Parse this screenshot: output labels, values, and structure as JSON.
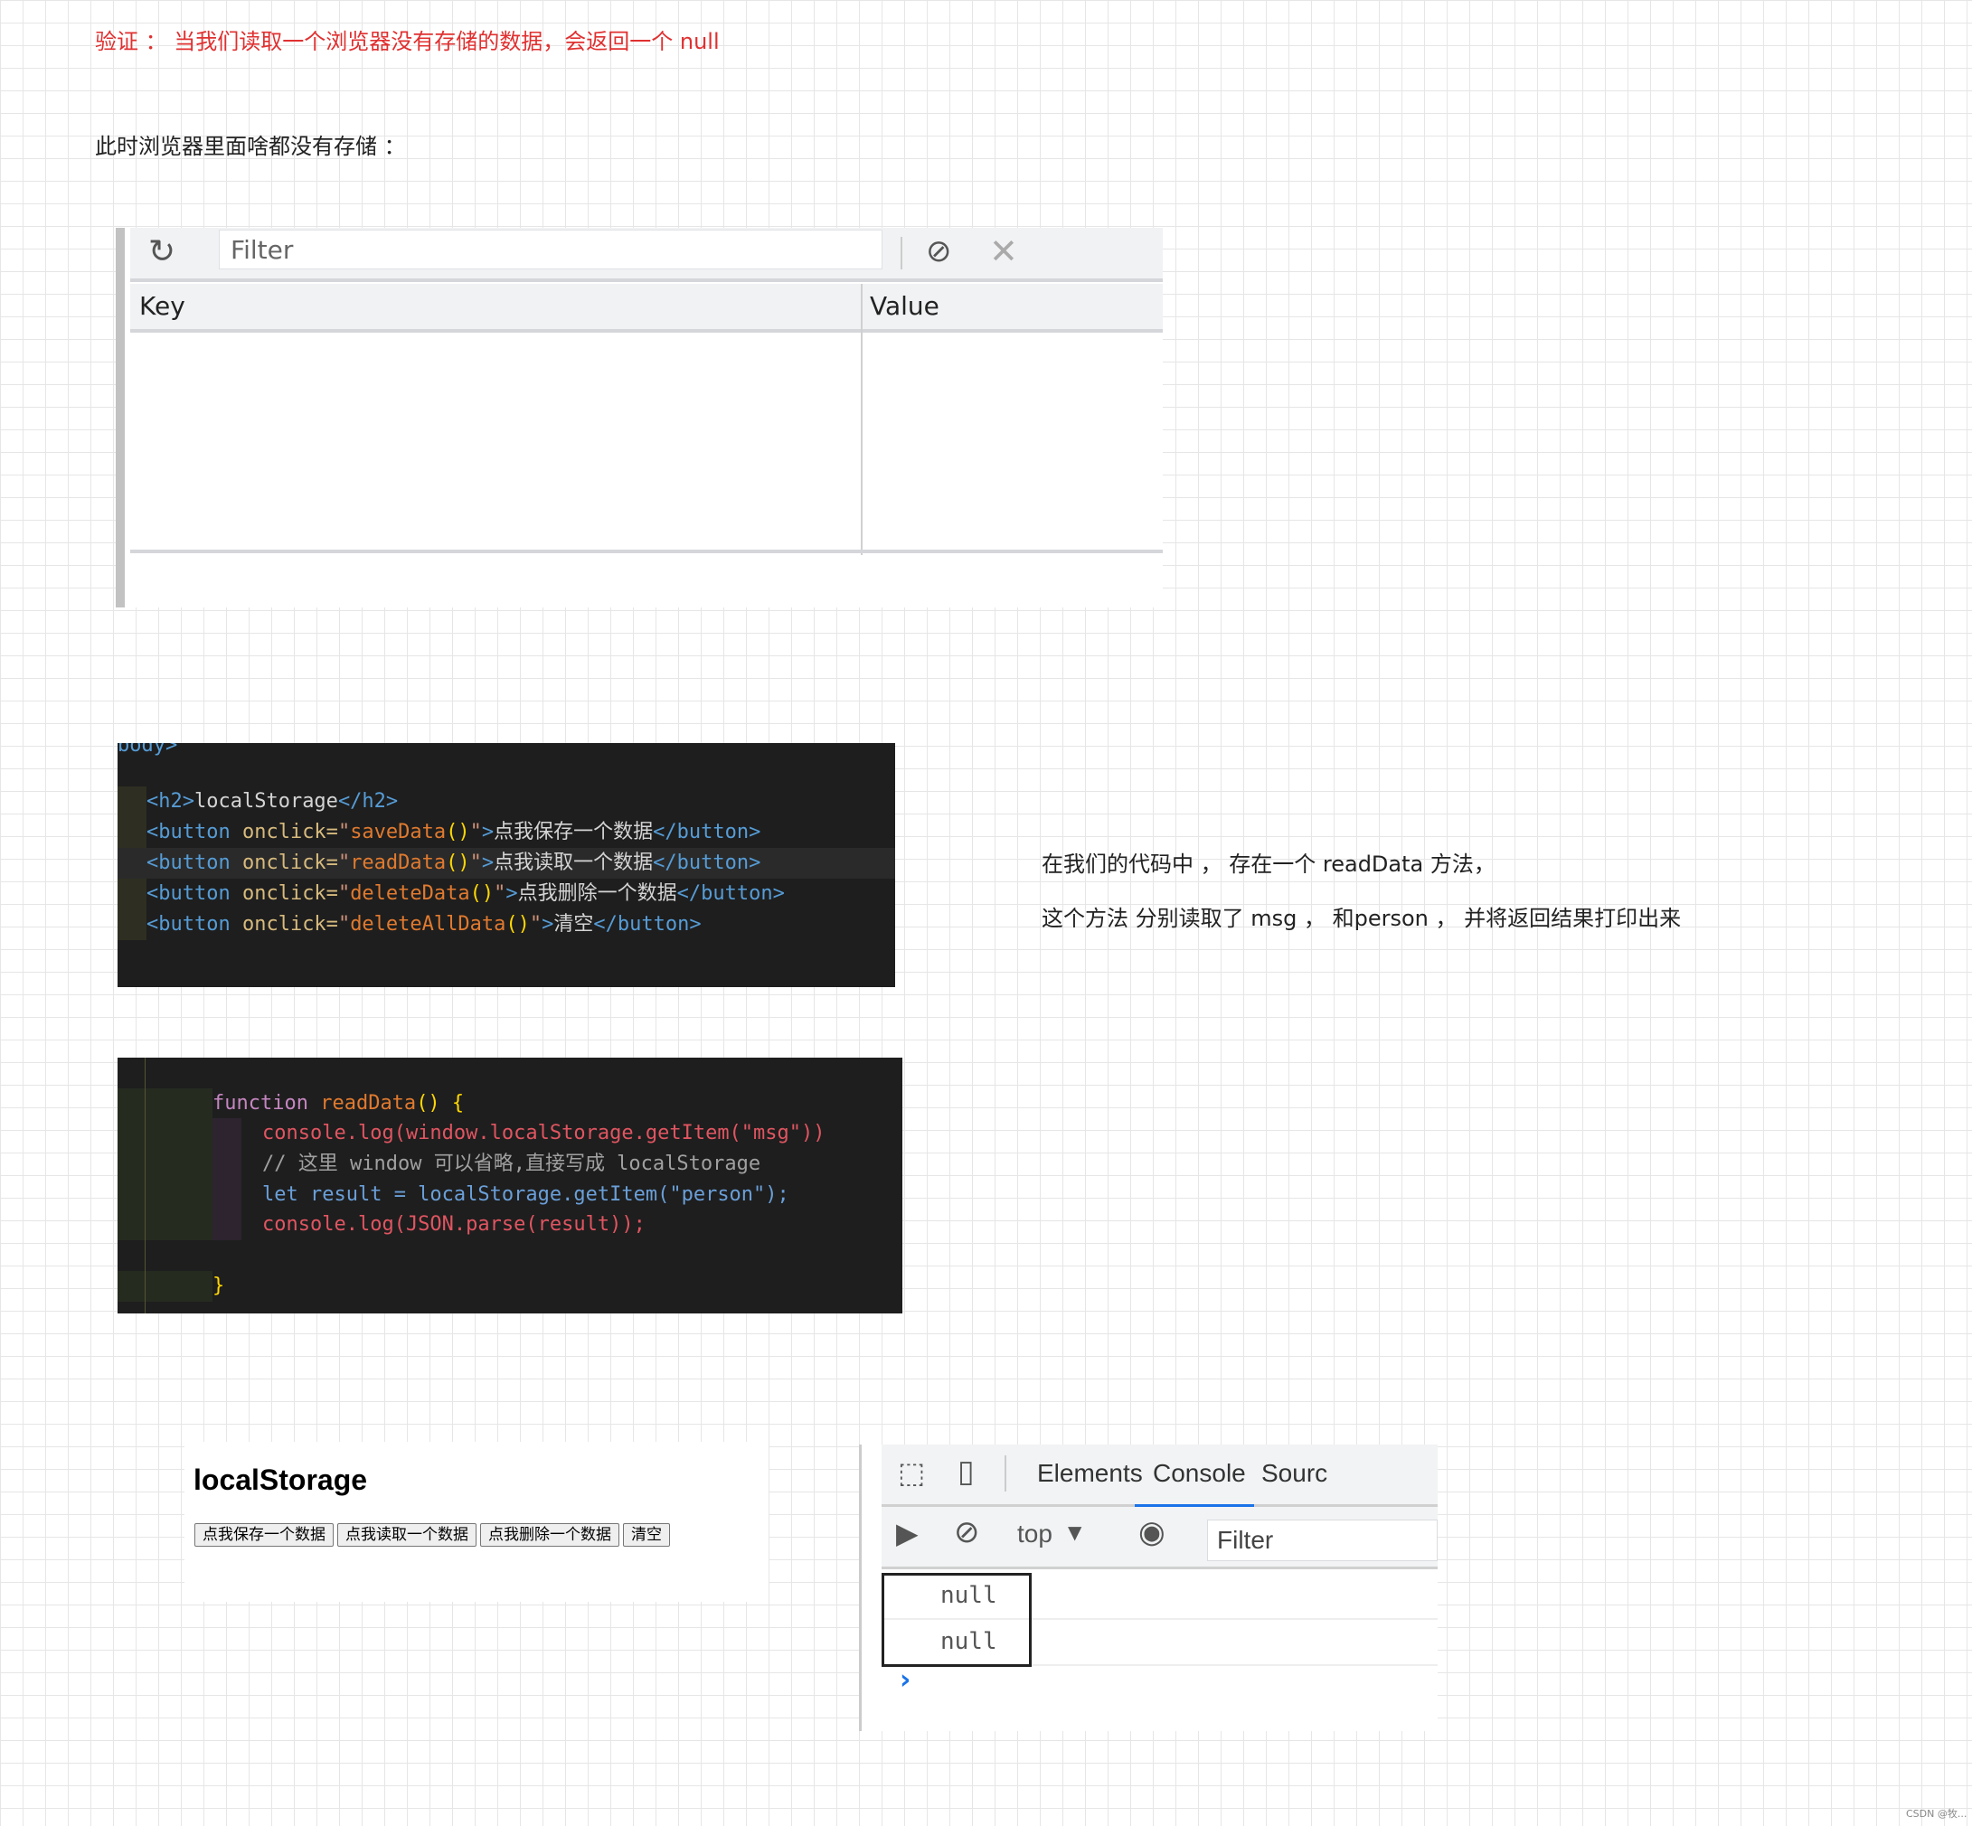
{
  "heading": "验证 ： 当我们读取一个浏览器没有存储的数据，会返回一个 null",
  "intro": "此时浏览器里面啥都没有存储 ：",
  "storage_panel": {
    "filter_placeholder": "Filter",
    "refresh_icon": "↻",
    "block_icon": "⊘",
    "clear_icon": "✕",
    "columns": [
      "Key",
      "Value"
    ],
    "rows": []
  },
  "code_html": {
    "cut_line": "body>",
    "lines": [
      {
        "tag_open": "<h2>",
        "text": "localStorage",
        "tag_close": "</h2>"
      },
      {
        "fn": "saveData",
        "label": "点我保存一个数据"
      },
      {
        "fn": "readData",
        "label": "点我读取一个数据"
      },
      {
        "fn": "deleteData",
        "label": "点我删除一个数据"
      },
      {
        "fn": "deleteAllData",
        "label": "清空"
      }
    ],
    "button_tag": "<button",
    "onclick": " onclick=",
    "close_tag": "</button>"
  },
  "code_js": {
    "line1_kw": "function",
    "line1_name": " readData",
    "line1_rest": "() {",
    "line2": "console.log(window.localStorage.getItem(\"msg\"))",
    "line3": "// 这里 window 可以省略,直接写成 localStorage",
    "line4": "let result = localStorage.getItem(\"person\");",
    "line5": "console.log(JSON.parse(result));",
    "line6": "}"
  },
  "notes": {
    "line1": "在我们的代码中 ， 存在一个 readData 方法，",
    "line2": "这个方法 分别读取了 msg ， 和person ， 并将返回结果打印出来"
  },
  "preview": {
    "title": "localStorage",
    "buttons": [
      "点我保存一个数据",
      "点我读取一个数据",
      "点我删除一个数据",
      "清空"
    ]
  },
  "devtools": {
    "tabs": [
      "Elements",
      "Console",
      "Sourc"
    ],
    "active_tab": "Console",
    "context": "top",
    "filter_placeholder": "Filter",
    "logs": [
      "null",
      "null"
    ],
    "prompt": "›"
  },
  "watermark": "CSDN @牧..."
}
